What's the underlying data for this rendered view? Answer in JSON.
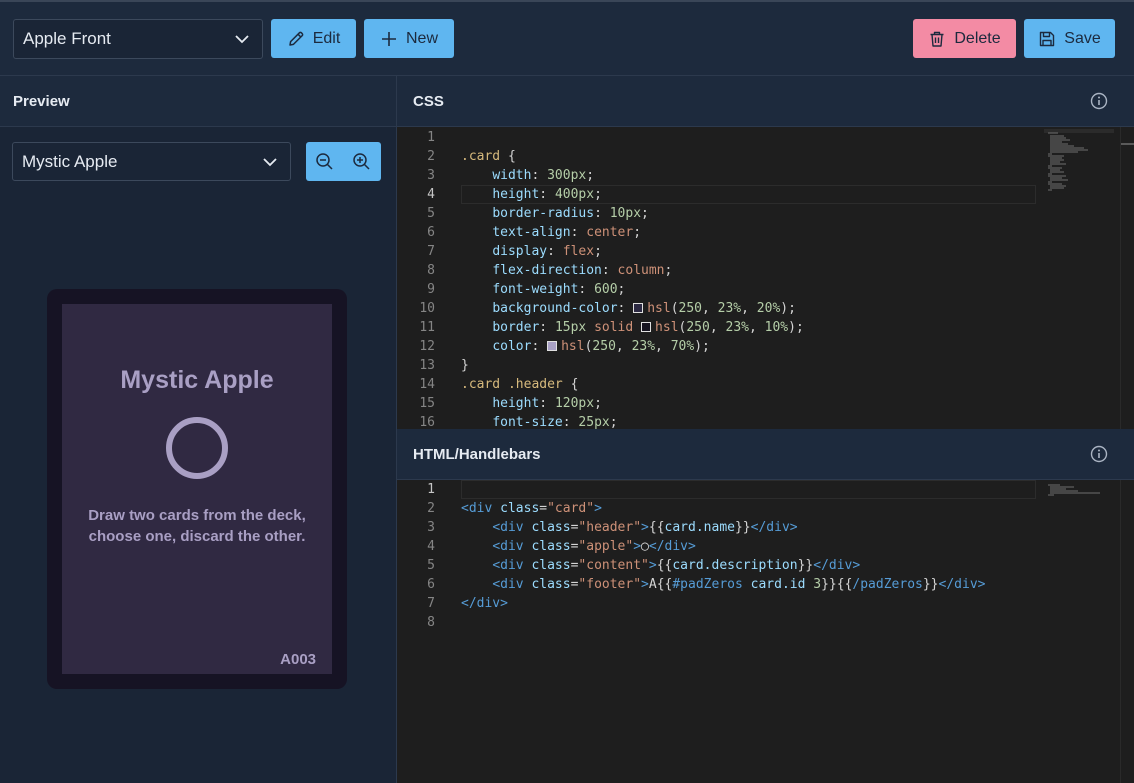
{
  "toolbar": {
    "template_select": "Apple Front",
    "edit_label": "Edit",
    "new_label": "New",
    "delete_label": "Delete",
    "save_label": "Save",
    "accent_color": "#5fb6f0",
    "danger_color": "#f38ba4"
  },
  "preview": {
    "title": "Preview",
    "card_select": "Mystic Apple",
    "card": {
      "name": "Mystic Apple",
      "description": "Draw two cards from the deck, choose one, discard the other.",
      "footer": "A003"
    }
  },
  "css_editor": {
    "title": "CSS",
    "active_line": 4,
    "line_numbers": [
      "1",
      "2",
      "3",
      "4",
      "5",
      "6",
      "7",
      "8",
      "9",
      "10",
      "11",
      "12",
      "13",
      "14",
      "15",
      "16"
    ]
  },
  "html_editor": {
    "title": "HTML/Handlebars",
    "active_line": 1,
    "line_numbers": [
      "1",
      "2",
      "3",
      "4",
      "5",
      "6",
      "7",
      "8"
    ]
  },
  "icons": {
    "edit": "pencil-icon",
    "new": "plus-icon",
    "delete": "trash-icon",
    "save": "floppy-disk-icon",
    "zoom_out": "zoom-out-icon",
    "zoom_in": "zoom-in-icon",
    "info": "info-icon",
    "dropdown": "chevron-down-icon"
  }
}
